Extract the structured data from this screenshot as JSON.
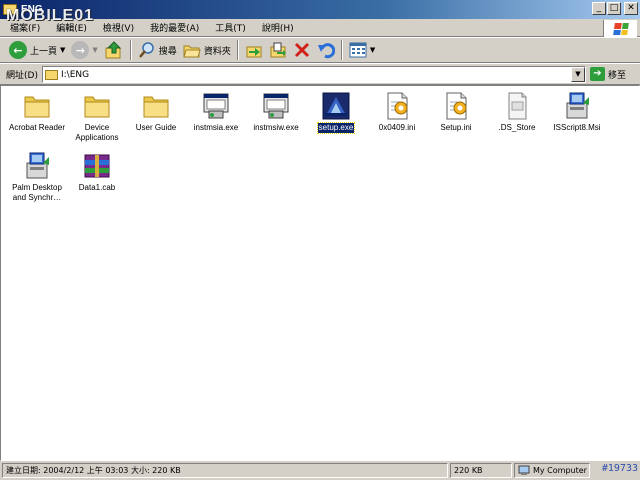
{
  "window": {
    "title": "ENG",
    "watermark": "MOBILE01"
  },
  "menu": [
    "檔案(F)",
    "編輯(E)",
    "檢視(V)",
    "我的最愛(A)",
    "工具(T)",
    "說明(H)"
  ],
  "toolbar": {
    "back_label": "上一頁",
    "search_label": "搜尋",
    "folders_label": "資料夾"
  },
  "address": {
    "label": "網址(D)",
    "value": "I:\\ENG",
    "go_label": "移至"
  },
  "files": [
    {
      "name": "Acrobat Reader",
      "icon": "folder-icon"
    },
    {
      "name": "Device Applications",
      "icon": "folder-icon"
    },
    {
      "name": "User Guide",
      "icon": "folder-icon"
    },
    {
      "name": "instmsia.exe",
      "icon": "installer-exe-icon"
    },
    {
      "name": "instmsiw.exe",
      "icon": "installer-exe-icon"
    },
    {
      "name": "setup.exe",
      "icon": "setup-exe-icon",
      "selected": true
    },
    {
      "name": "0x0409.ini",
      "icon": "ini-file-icon"
    },
    {
      "name": "Setup.ini",
      "icon": "ini-file-icon"
    },
    {
      "name": ".DS_Store",
      "icon": "generic-file-icon"
    },
    {
      "name": "ISScript8.Msi",
      "icon": "msi-package-icon"
    },
    {
      "name": "Palm Desktop and Synchr…",
      "icon": "msi-package-icon"
    },
    {
      "name": "Data1.cab",
      "icon": "cab-archive-icon"
    }
  ],
  "status": {
    "info": "建立日期: 2004/2/12 上午 03:03 大小: 220 KB",
    "size": "220 KB",
    "zone": "My Computer",
    "tag": "#19733"
  },
  "colors": {
    "titlebar": "#0a246a",
    "folder": "#f5d76e",
    "selection": "#0a246a"
  }
}
